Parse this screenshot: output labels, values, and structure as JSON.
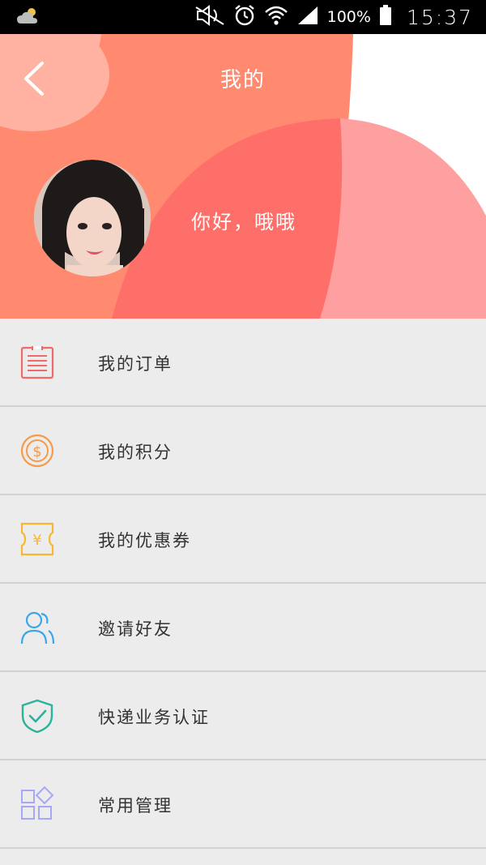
{
  "status_bar": {
    "battery_percent": "100%",
    "time": "15:37",
    "icons": [
      "weather-cloud-icon",
      "mute-icon",
      "alarm-icon",
      "wifi-icon",
      "signal-icon",
      "battery-icon"
    ]
  },
  "header": {
    "title": "我的",
    "greeting": "你好，哦哦",
    "colors": {
      "primary": "#ff8a70",
      "secondary": "#ff6f6a",
      "accent": "#ffa0a0"
    }
  },
  "menu": {
    "items": [
      {
        "label": "我的订单",
        "icon": "order-list-icon",
        "color": "#f06a6a"
      },
      {
        "label": "我的积分",
        "icon": "points-coin-icon",
        "color": "#f59a4a"
      },
      {
        "label": "我的优惠券",
        "icon": "coupon-icon",
        "color": "#f7b733"
      },
      {
        "label": "邀请好友",
        "icon": "invite-friends-icon",
        "color": "#3aa7e8"
      },
      {
        "label": "快递业务认证",
        "icon": "verified-shield-icon",
        "color": "#2bb39b"
      },
      {
        "label": "常用管理",
        "icon": "management-grid-icon",
        "color": "#a7a7f3"
      }
    ]
  }
}
